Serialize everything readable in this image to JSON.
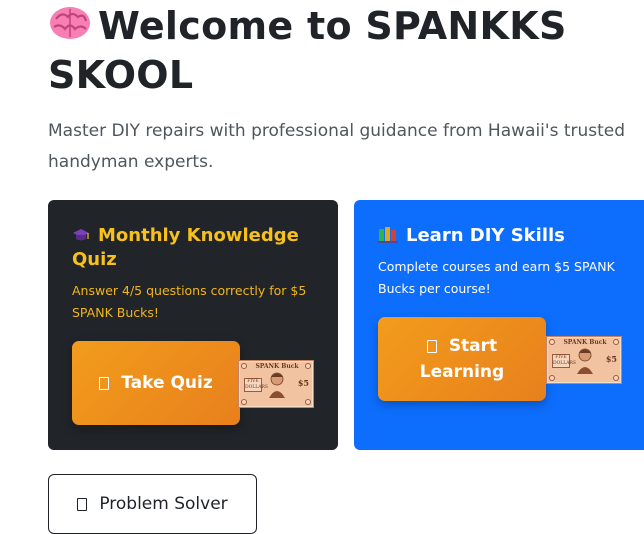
{
  "hero": {
    "title": "Welcome to SPANKKS SKOOL",
    "title_icon": "brain-icon",
    "subtitle": "Master DIY repairs with professional guidance from Hawaii's trusted handyman experts."
  },
  "quiz_card": {
    "icon": "graduation-cap-icon",
    "title": "Monthly Knowledge Quiz",
    "description": "Answer 4/5 questions correctly for $5 SPANK Bucks!",
    "button_label": "Take Quiz",
    "accent": "#f7c01b",
    "background": "#212428"
  },
  "learn_card": {
    "icon": "books-icon",
    "title": "Learn DIY Skills",
    "description": "Complete courses and earn $5 SPANK Bucks per course!",
    "button_line1": "Start",
    "button_line2": "Learning",
    "background": "#0d6efd"
  },
  "spank_buck": {
    "top_text": "SPANK Buck",
    "left_text": "FIVE DOLLARS",
    "value": "$5"
  },
  "problem_solver": {
    "label": "Problem Solver"
  },
  "colors": {
    "button_gradient_start": "#f29c1c",
    "button_gradient_end": "#e8801d"
  }
}
